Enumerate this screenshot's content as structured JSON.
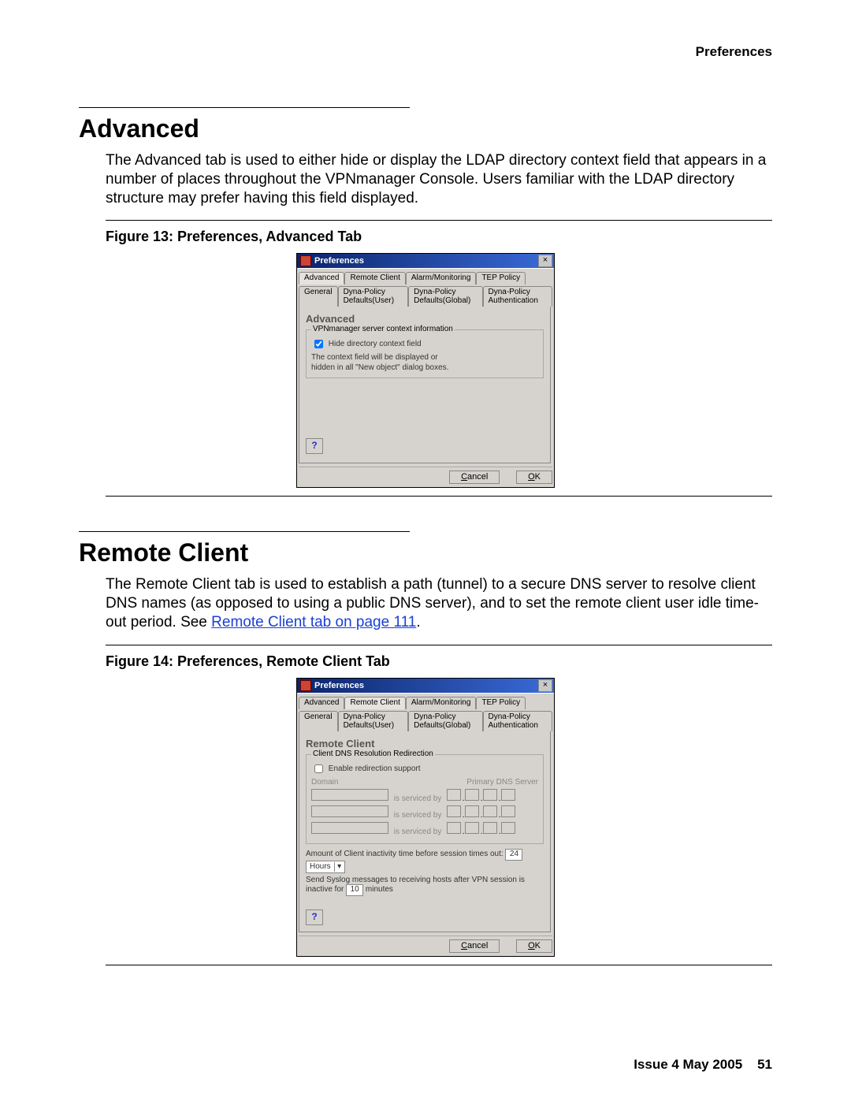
{
  "running_head": "Preferences",
  "advanced": {
    "title": "Advanced",
    "para": "The Advanced tab is used to either hide or display the LDAP directory context field that appears in a number of places throughout the VPNmanager Console. Users familiar with the LDAP directory structure may prefer having this field displayed.",
    "fig_caption": "Figure 13: Preferences, Advanced Tab"
  },
  "remote": {
    "title": "Remote Client",
    "para_prefix": "The Remote Client tab is used to establish a path (tunnel) to a secure DNS server to resolve client DNS names (as opposed to using a public DNS server), and to set the remote client user idle time-out period. See ",
    "para_link": "Remote Client tab on page 111",
    "para_suffix": ".",
    "fig_caption": "Figure 14: Preferences, Remote Client Tab"
  },
  "dlg_common": {
    "title": "Preferences",
    "tabs_row1": [
      "Advanced",
      "Remote Client",
      "Alarm/Monitoring",
      "TEP Policy"
    ],
    "tabs_row2": [
      "General",
      "Dyna-Policy Defaults(User)",
      "Dyna-Policy Defaults(Global)",
      "Dyna-Policy Authentication"
    ],
    "help": "?",
    "cancel": "Cancel",
    "ok": "OK"
  },
  "dlg_advanced": {
    "panel_title": "Advanced",
    "group_title": "VPNmanager server context information",
    "checkbox_label": "Hide directory context field",
    "hint1": "The context field will be displayed or",
    "hint2": "hidden in all \"New object\" dialog boxes."
  },
  "dlg_remote": {
    "panel_title": "Remote Client",
    "group_title": "Client DNS Resolution Redirection",
    "enable_label": "Enable redirection support",
    "domain_label": "Domain",
    "primary_label": "Primary DNS Server",
    "serviced": "is serviced by",
    "inact_prefix": "Amount of Client inactivity time before session times out:",
    "inact_value": "24",
    "inact_unit": "Hours",
    "syslog_prefix": "Send Syslog messages to receiving hosts after VPN session is inactive for",
    "syslog_value": "10",
    "syslog_unit": "minutes"
  },
  "footer": {
    "issue": "Issue 4   May 2005",
    "page": "51"
  }
}
